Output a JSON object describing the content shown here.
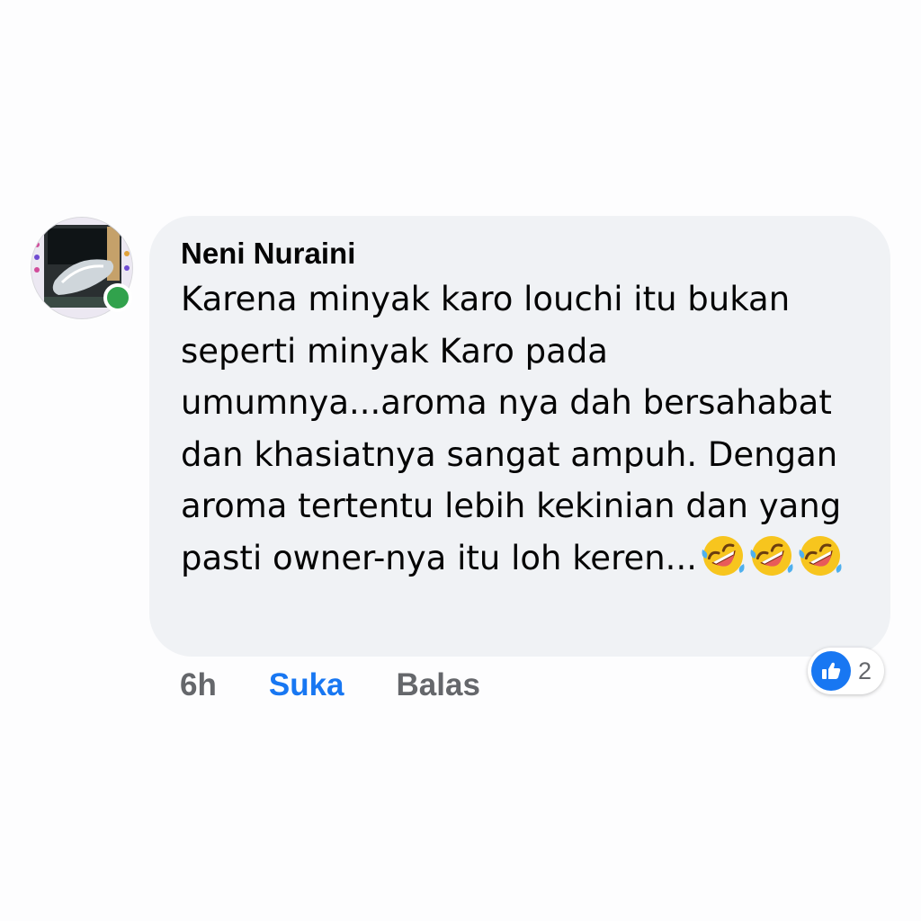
{
  "comment": {
    "author": "Neni Nuraini",
    "text": "Karena minyak karo louchi itu bukan seperti minyak Karo pada umumnya...aroma nya dah bersahabat dan khasiatnya sangat ampuh. Dengan aroma tertentu lebih kekinian dan yang pasti owner-nya itu loh keren...",
    "emojis": [
      "rolling-on-floor-laughing",
      "rolling-on-floor-laughing",
      "rolling-on-floor-laughing"
    ],
    "online": true
  },
  "actions": {
    "timestamp": "6h",
    "like_label": "Suka",
    "reply_label": "Balas"
  },
  "reactions": {
    "icon": "thumbs-up-icon",
    "count": "2"
  },
  "colors": {
    "bubble": "#f0f2f5",
    "like_blue": "#1877f2",
    "secondary_text": "#65676b",
    "online_green": "#31a24c"
  }
}
